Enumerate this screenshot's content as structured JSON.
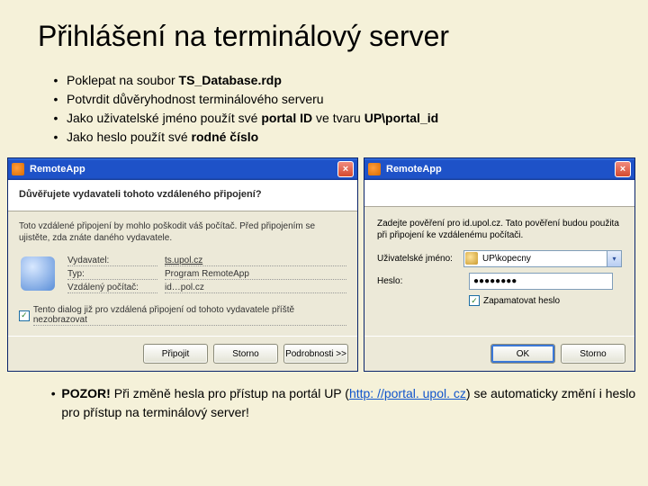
{
  "title": "Přihlášení na terminálový server",
  "bullets": [
    {
      "pre": "Poklepat na soubor ",
      "bold": "TS_Database.rdp",
      "post": ""
    },
    {
      "pre": "Potvrdit důvěryhodnost terminálového serveru",
      "bold": "",
      "post": ""
    },
    {
      "pre": "Jako uživatelské jméno použít své ",
      "bold": "portal ID",
      "post": " ve tvaru ",
      "bold2": "UP\\portal_id"
    },
    {
      "pre": "Jako heslo použít své ",
      "bold": "rodné číslo",
      "post": ""
    }
  ],
  "dlg1": {
    "app": "RemoteApp",
    "question": "Důvěřujete vydavateli tohoto vzdáleného připojení?",
    "desc": "Toto vzdálené připojení by mohlo poškodit váš počítač. Před připojením se ujistěte, zda znáte daného vydavatele.",
    "kv": [
      {
        "k": "Vydavatel:",
        "v": "ts.upol.cz",
        "link": true
      },
      {
        "k": "Typ:",
        "v": "Program RemoteApp",
        "link": false
      },
      {
        "k": "Vzdálený počítač:",
        "v": "id…pol.cz",
        "link": false
      }
    ],
    "checkbox": "Tento dialog již pro vzdálená připojení od tohoto vydavatele příště nezobrazovat",
    "buttons": {
      "connect": "Připojit",
      "cancel": "Storno",
      "details": "Podrobnosti >>"
    }
  },
  "dlg2": {
    "app": "RemoteApp",
    "desc": "Zadejte pověření pro id.upol.cz. Tato pověření budou použita při připojení ke vzdálenému počítači.",
    "user_label": "Uživatelské jméno:",
    "user_value": "UP\\kopecny",
    "pass_label": "Heslo:",
    "pass_value": "●●●●●●●●",
    "remember": "Zapamatovat heslo",
    "buttons": {
      "ok": "OK",
      "cancel": "Storno"
    }
  },
  "footer": {
    "bold": "POZOR!",
    "pre": "  Při změně hesla pro přístup na portál UP (",
    "url_text": "http: //portal. upol. cz",
    "post": ") se automaticky změní i heslo pro přístup na terminálový server!"
  }
}
